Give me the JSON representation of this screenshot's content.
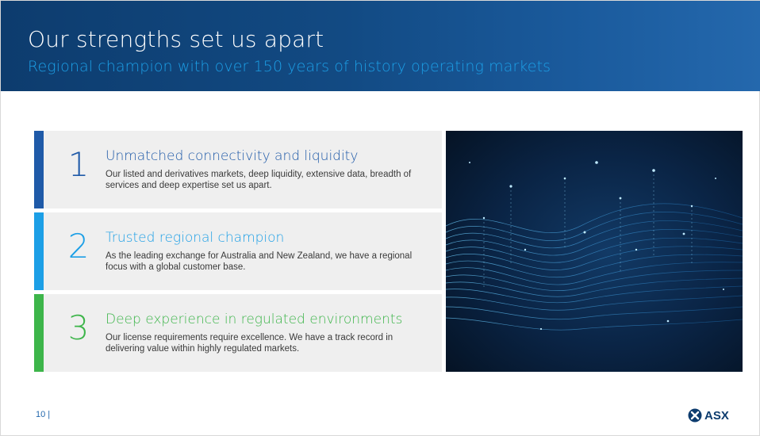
{
  "header": {
    "title": "Our strengths set us apart",
    "subtitle": "Regional champion with over 150 years of history operating markets"
  },
  "cards": [
    {
      "number": "1",
      "title": "Unmatched connectivity and liquidity",
      "body": "Our listed and derivatives markets, deep liquidity, extensive data, breadth of services and deep expertise set us apart.",
      "color": "#1f5aa8"
    },
    {
      "number": "2",
      "title": "Trusted regional champion",
      "body": "As the leading exchange for Australia and New Zealand, we have a regional focus with a global customer base.",
      "color": "#1c9fe6"
    },
    {
      "number": "3",
      "title": "Deep experience in regulated environments",
      "body": "Our license requirements require excellence. We have a track record in delivering value within highly regulated markets.",
      "color": "#3db54a"
    }
  ],
  "footer": {
    "page_number": "10 |",
    "logo_text": "ASX"
  },
  "colors": {
    "header_bg": "#124a83",
    "subtitle": "#1c9fe6"
  }
}
